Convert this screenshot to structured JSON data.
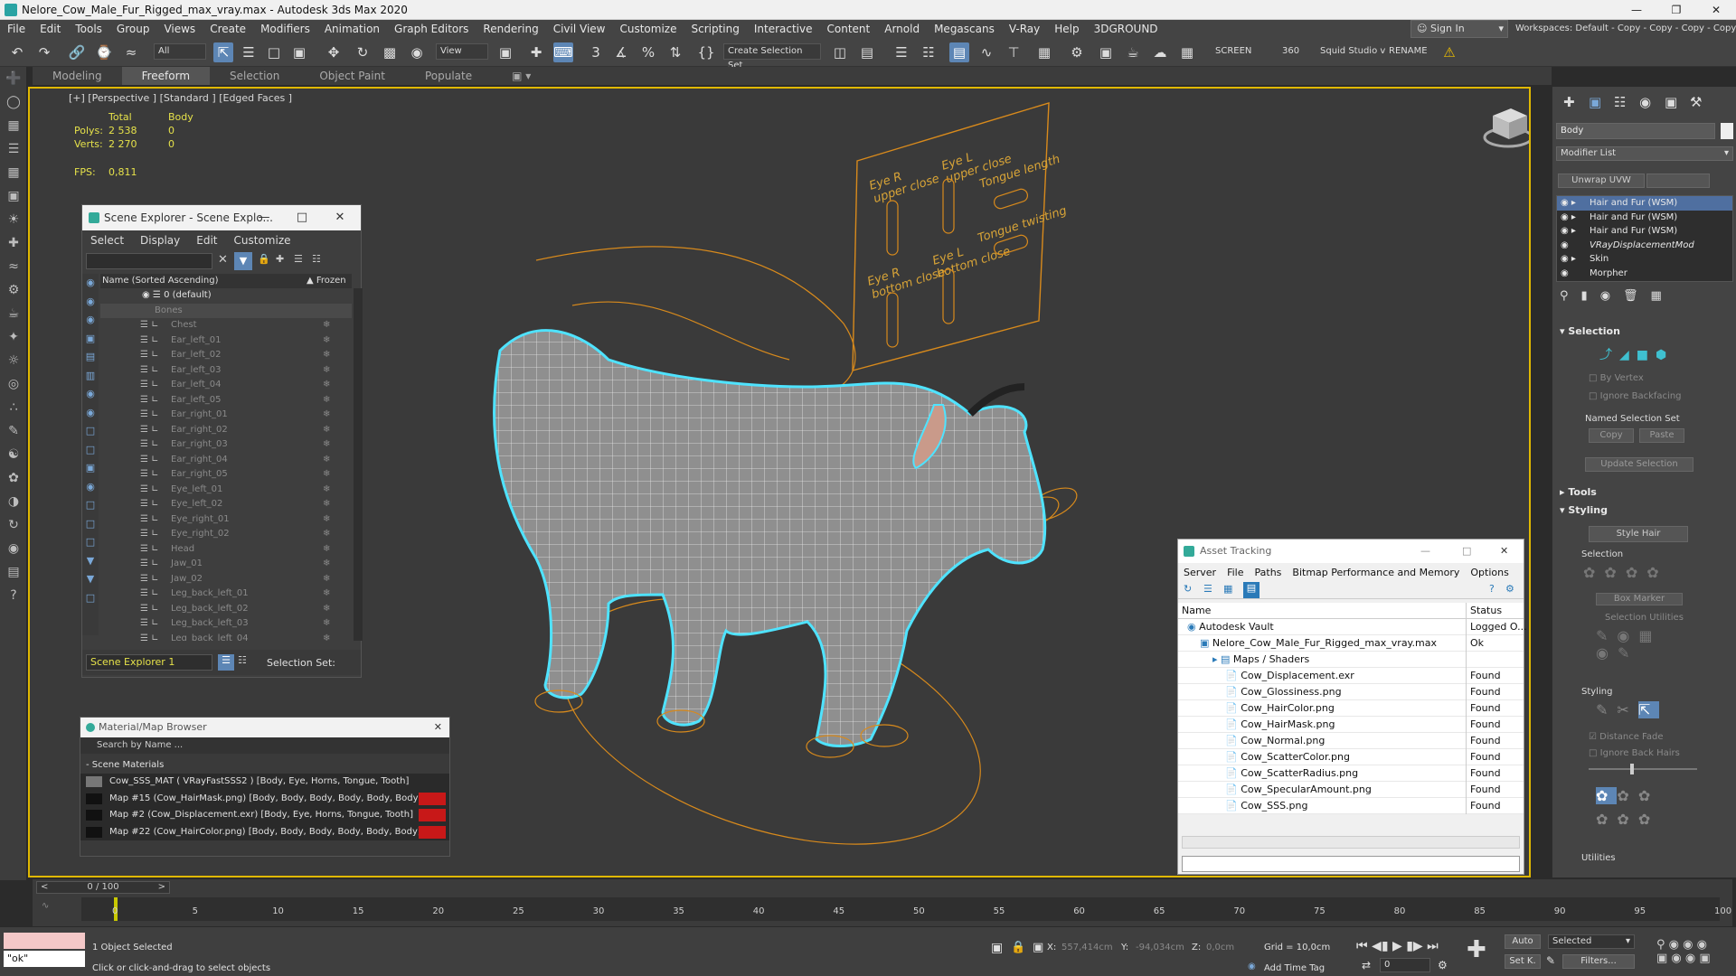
{
  "window": {
    "title": "Nelore_Cow_Male_Fur_Rigged_max_vray.max - Autodesk 3ds Max 2020"
  },
  "menu": [
    "File",
    "Edit",
    "Tools",
    "Group",
    "Views",
    "Create",
    "Modifiers",
    "Animation",
    "Graph Editors",
    "Rendering",
    "Civil View",
    "Customize",
    "Scripting",
    "Interactive",
    "Content",
    "Arnold",
    "Megascans",
    "V-Ray",
    "Help",
    "3DGROUND"
  ],
  "signin": "Sign In",
  "workspaces": "Workspaces:  Default - Copy - Copy - Copy - Copy",
  "toolbar": {
    "filter": "All",
    "refcoord": "View",
    "selset": "Create Selection Set",
    "screen": "SCREEN",
    "num360": "360",
    "squid": "Squid Studio v",
    "rename": "RENAME"
  },
  "ribbon": [
    "Modeling",
    "Freeform",
    "Selection",
    "Object Paint",
    "Populate"
  ],
  "viewport": {
    "label": "[+] [Perspective ] [Standard ] [Edged Faces ]",
    "stats_head": {
      "total": "Total",
      "body": "Body"
    },
    "polys_label": "Polys:",
    "polys_total": "2 538",
    "polys_body": "0",
    "verts_label": "Verts:",
    "verts_total": "2 270",
    "verts_body": "0",
    "fps_label": "FPS:",
    "fps": "0,811",
    "board": {
      "eye_r_upper": "Eye R\nupper close",
      "eye_l_upper": "Eye L\nupper close",
      "tongue_length": "Tongue length",
      "eye_r_bottom": "Eye R\nbottom close",
      "eye_l_bottom": "Eye L\nbottom close",
      "tongue_twisting": "Tongue twisting"
    }
  },
  "scene_explorer": {
    "title": "Scene Explorer - Scene Explo...",
    "menu": [
      "Select",
      "Display",
      "Edit",
      "Customize"
    ],
    "col_name": "Name (Sorted Ascending)",
    "col_frozen": "▲ Frozen",
    "root": "0 (default)",
    "group": "Bones",
    "items": [
      "Chest",
      "Ear_left_01",
      "Ear_left_02",
      "Ear_left_03",
      "Ear_left_04",
      "Ear_left_05",
      "Ear_right_01",
      "Ear_right_02",
      "Ear_right_03",
      "Ear_right_04",
      "Ear_right_05",
      "Eye_left_01",
      "Eye_left_02",
      "Eye_right_01",
      "Eye_right_02",
      "Head",
      "Jaw_01",
      "Jaw_02",
      "Leg_back_left_01",
      "Leg_back_left_02",
      "Leg_back_left_03",
      "Leg_back_left_04"
    ],
    "footer_name": "Scene Explorer 1",
    "selection_set": "Selection Set:"
  },
  "material_browser": {
    "title": "Material/Map Browser",
    "search": "Search by Name ...",
    "section": "- Scene Materials",
    "rows": [
      "Cow_SSS_MAT  ( VRayFastSSS2 )  [Body, Eye, Horns, Tongue, Tooth]",
      "Map #15 (Cow_HairMask.png)  [Body, Body, Body, Body, Body, Body]",
      "Map #2 (Cow_Displacement.exr)  [Body, Eye, Horns, Tongue, Tooth]",
      "Map #22 (Cow_HairColor.png)  [Body, Body, Body, Body, Body, Body]"
    ]
  },
  "asset_tracking": {
    "title": "Asset Tracking",
    "menu": [
      "Server",
      "File",
      "Paths",
      "Bitmap Performance and Memory",
      "Options"
    ],
    "col_name": "Name",
    "col_status": "Status",
    "rows": [
      {
        "name": "Autodesk Vault",
        "status": "Logged O...",
        "indent": 0
      },
      {
        "name": "Nelore_Cow_Male_Fur_Rigged_max_vray.max",
        "status": "Ok",
        "indent": 1
      },
      {
        "name": "Maps / Shaders",
        "status": "",
        "indent": 2
      },
      {
        "name": "Cow_Displacement.exr",
        "status": "Found",
        "indent": 3
      },
      {
        "name": "Cow_Glossiness.png",
        "status": "Found",
        "indent": 3
      },
      {
        "name": "Cow_HairColor.png",
        "status": "Found",
        "indent": 3
      },
      {
        "name": "Cow_HairMask.png",
        "status": "Found",
        "indent": 3
      },
      {
        "name": "Cow_Normal.png",
        "status": "Found",
        "indent": 3
      },
      {
        "name": "Cow_ScatterColor.png",
        "status": "Found",
        "indent": 3
      },
      {
        "name": "Cow_ScatterRadius.png",
        "status": "Found",
        "indent": 3
      },
      {
        "name": "Cow_SpecularAmount.png",
        "status": "Found",
        "indent": 3
      },
      {
        "name": "Cow_SSS.png",
        "status": "Found",
        "indent": 3
      }
    ]
  },
  "command_panel": {
    "object_name": "Body",
    "modifier_list": "Modifier List",
    "unwrap": "Unwrap UVW",
    "stack": [
      "Hair and Fur (WSM)",
      "Hair and Fur (WSM)",
      "Hair and Fur (WSM)",
      "VRayDisplacementMod",
      "Skin",
      "Morpher"
    ],
    "selection": "Selection",
    "by_vertex": "By Vertex",
    "ignore_backfacing": "Ignore Backfacing",
    "named_sel": "Named Selection Set",
    "copy": "Copy",
    "paste": "Paste",
    "update_sel": "Update Selection",
    "tools": "Tools",
    "styling": "Styling",
    "style_hair": "Style Hair",
    "sub_selection": "Selection",
    "box_marker": "Box Marker",
    "sel_utilities": "Selection Utilities",
    "sub_styling": "Styling",
    "distance_fade": "Distance Fade",
    "ignore_back_hairs": "Ignore Back Hairs",
    "utilities": "Utilities"
  },
  "timeline": {
    "frame": "0 / 100",
    "ticks": [
      "0",
      "5",
      "10",
      "15",
      "20",
      "25",
      "30",
      "35",
      "40",
      "45",
      "50",
      "55",
      "60",
      "65",
      "70",
      "75",
      "80",
      "85",
      "90",
      "95",
      "100"
    ]
  },
  "status": {
    "maxscript": "\"ok\"",
    "selected": "1 Object Selected",
    "prompt": "Click or click-and-drag to select objects",
    "x_label": "X:",
    "x": "557,414cm",
    "y_label": "Y:",
    "y": "-94,034cm",
    "z_label": "Z:",
    "z": "0,0cm",
    "grid": "Grid = 10,0cm",
    "add_time_tag": "Add Time Tag",
    "frame_field": "0",
    "auto": "Auto",
    "setk": "Set K.",
    "sel_dropdown": "Selected",
    "filters": "Filters..."
  },
  "colors": {
    "accent": "#5d86b5",
    "frame": "#e0b800",
    "selection": "#4fe3ff",
    "rig": "#d88a1c"
  }
}
